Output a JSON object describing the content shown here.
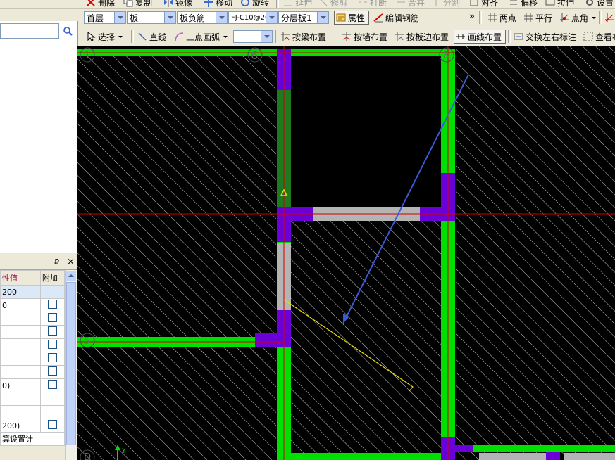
{
  "window": {
    "top_toolbar": [
      {
        "label": "删除",
        "icon": "delete-icon"
      },
      {
        "label": "复制",
        "icon": "copy-icon"
      },
      {
        "label": "镜像",
        "icon": "mirror-icon"
      },
      {
        "label": "移动",
        "icon": "move-icon"
      },
      {
        "label": "旋转",
        "icon": "rotate-icon"
      },
      {
        "label": "延伸",
        "icon": "extend-icon"
      },
      {
        "label": "修剪",
        "icon": "trim-icon"
      },
      {
        "label": "打断",
        "icon": "break-icon"
      },
      {
        "label": "合并",
        "icon": "merge-icon"
      },
      {
        "label": "分割",
        "icon": "split-icon"
      },
      {
        "label": "对齐",
        "icon": "align-icon"
      },
      {
        "label": "偏移",
        "icon": "offset-icon"
      },
      {
        "label": "拉伸",
        "icon": "stretch-icon"
      },
      {
        "label": "设置",
        "icon": "settings-icon"
      }
    ],
    "selectors": {
      "floor": "首层",
      "element_type": "板",
      "subtype": "板负筋",
      "element_name": "FJ-C10@20(",
      "layer": "分层板1"
    },
    "toolbar1": {
      "attributes": "属性",
      "edit_rebar": "编辑钢筋",
      "more": "»",
      "two_points": "两点",
      "parallel": "平行",
      "point_angle": "点角"
    },
    "toolbar2": {
      "select": "选择",
      "line": "直线",
      "three_point_arc": "三点画弧",
      "combo_value": "",
      "by_beam": "按梁布置",
      "by_wall": "按墙布置",
      "by_slab_edge": "按板边布置",
      "draw_line": "画线布置",
      "swap_labels": "交换左右标注",
      "view": "查看布"
    },
    "properties_panel": {
      "pin": "₽",
      "close": "×",
      "col_value": "性值",
      "col_extra": "附加",
      "rows": [
        {
          "value": "200",
          "checkbox": false
        },
        {
          "value": "0",
          "checkbox": true
        },
        {
          "value": "",
          "checkbox": true
        },
        {
          "value": "",
          "checkbox": true
        },
        {
          "value": "",
          "checkbox": true
        },
        {
          "value": "",
          "checkbox": true
        },
        {
          "value": "",
          "checkbox": true
        },
        {
          "value": "0)",
          "checkbox": true
        },
        {
          "value": "",
          "checkbox": false
        },
        {
          "value": "",
          "checkbox": false
        },
        {
          "value": "200)",
          "checkbox": true
        },
        {
          "value": "算设置计",
          "checkbox": false
        }
      ]
    },
    "canvas": {
      "axis_labels": {
        "top_left": "1",
        "top_mid": "6",
        "top_right": "8",
        "left": "5",
        "bottom_left": "D"
      },
      "colors": {
        "background": "#000000",
        "wall_green": "#00e000",
        "column_purple": "#6a00d8",
        "hatch": "#c8c8c8",
        "rebar_blue": "#3a5ad8",
        "rebar_yellow": "#e8e000",
        "axis_red": "#d00000"
      }
    }
  }
}
